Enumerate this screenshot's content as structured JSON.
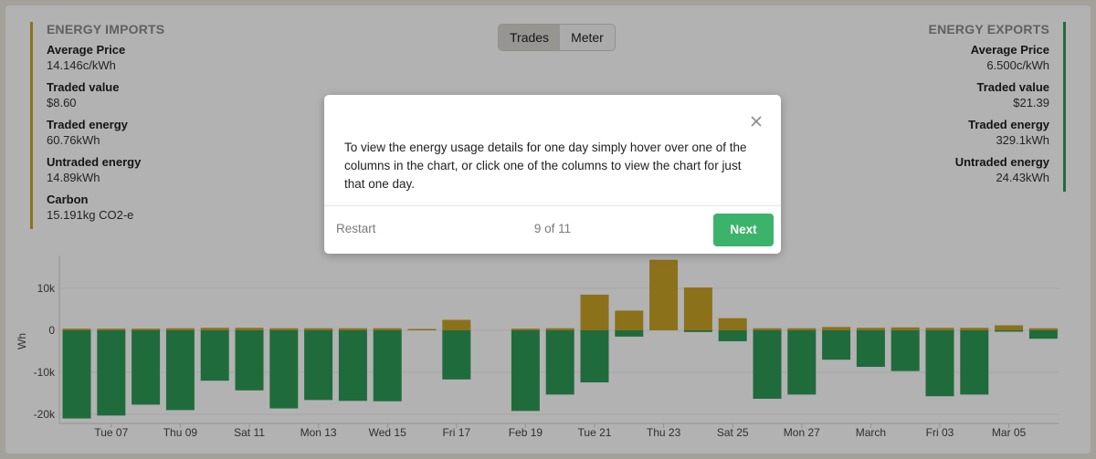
{
  "imports": {
    "title": "ENERGY IMPORTS",
    "stats": [
      {
        "label": "Average Price",
        "value": "14.146c/kWh"
      },
      {
        "label": "Traded value",
        "value": "$8.60"
      },
      {
        "label": "Traded energy",
        "value": "60.76kWh"
      },
      {
        "label": "Untraded energy",
        "value": "14.89kWh"
      },
      {
        "label": "Carbon",
        "value": "15.191kg CO2-e"
      }
    ]
  },
  "exports": {
    "title": "ENERGY EXPORTS",
    "stats": [
      {
        "label": "Average Price",
        "value": "6.500c/kWh"
      },
      {
        "label": "Traded value",
        "value": "$21.39"
      },
      {
        "label": "Traded energy",
        "value": "329.1kWh"
      },
      {
        "label": "Untraded energy",
        "value": "24.43kWh"
      }
    ]
  },
  "toggle": {
    "trades_label": "Trades",
    "meter_label": "Meter",
    "active": "Trades"
  },
  "colors": {
    "import": "#c9a227",
    "export": "#2e9a57",
    "next_button": "#3cb36a"
  },
  "modal": {
    "body": "To view the energy usage details for one day simply hover over one of the columns in the chart, or click one of the columns to view the chart for just that one day.",
    "restart_label": "Restart",
    "step_text": "9 of 11",
    "next_label": "Next",
    "close_icon": "close-icon"
  },
  "chart_data": {
    "type": "bar",
    "ylabel": "Wh",
    "ylim": [
      -22000,
      17000
    ],
    "y_ticks": [
      10000,
      0,
      -10000,
      -20000
    ],
    "y_tick_labels": [
      "10k",
      "0",
      "-10k",
      "-20k"
    ],
    "x_tick_labels": [
      "Tue 07",
      "Thu 09",
      "Sat 11",
      "Mon 13",
      "Wed 15",
      "Fri 17",
      "Feb 19",
      "Tue 21",
      "Thu 23",
      "Sat 25",
      "Mon 27",
      "March",
      "Fri 03",
      "Mar 05"
    ],
    "x_tick_index": [
      1,
      3,
      5,
      7,
      9,
      11,
      13,
      15,
      17,
      19,
      21,
      23,
      25,
      27
    ],
    "series": [
      {
        "values": [
          400,
          400,
          400,
          500,
          600,
          600,
          500,
          500,
          500,
          500,
          300,
          2500,
          0,
          400,
          500,
          8500,
          4700,
          16800,
          10200,
          2900,
          500,
          500,
          800,
          600,
          700,
          600,
          600,
          1200,
          500
        ]
      },
      {
        "values": [
          -21000,
          -20300,
          -17700,
          -19000,
          -12000,
          -14300,
          -18600,
          -16600,
          -16800,
          -16900,
          0,
          -11700,
          0,
          -19200,
          -15300,
          -12400,
          -1500,
          0,
          -400,
          -2600,
          -16300,
          -15300,
          -7000,
          -8700,
          -9700,
          -15700,
          -15300,
          -200,
          -2000
        ]
      }
    ]
  }
}
